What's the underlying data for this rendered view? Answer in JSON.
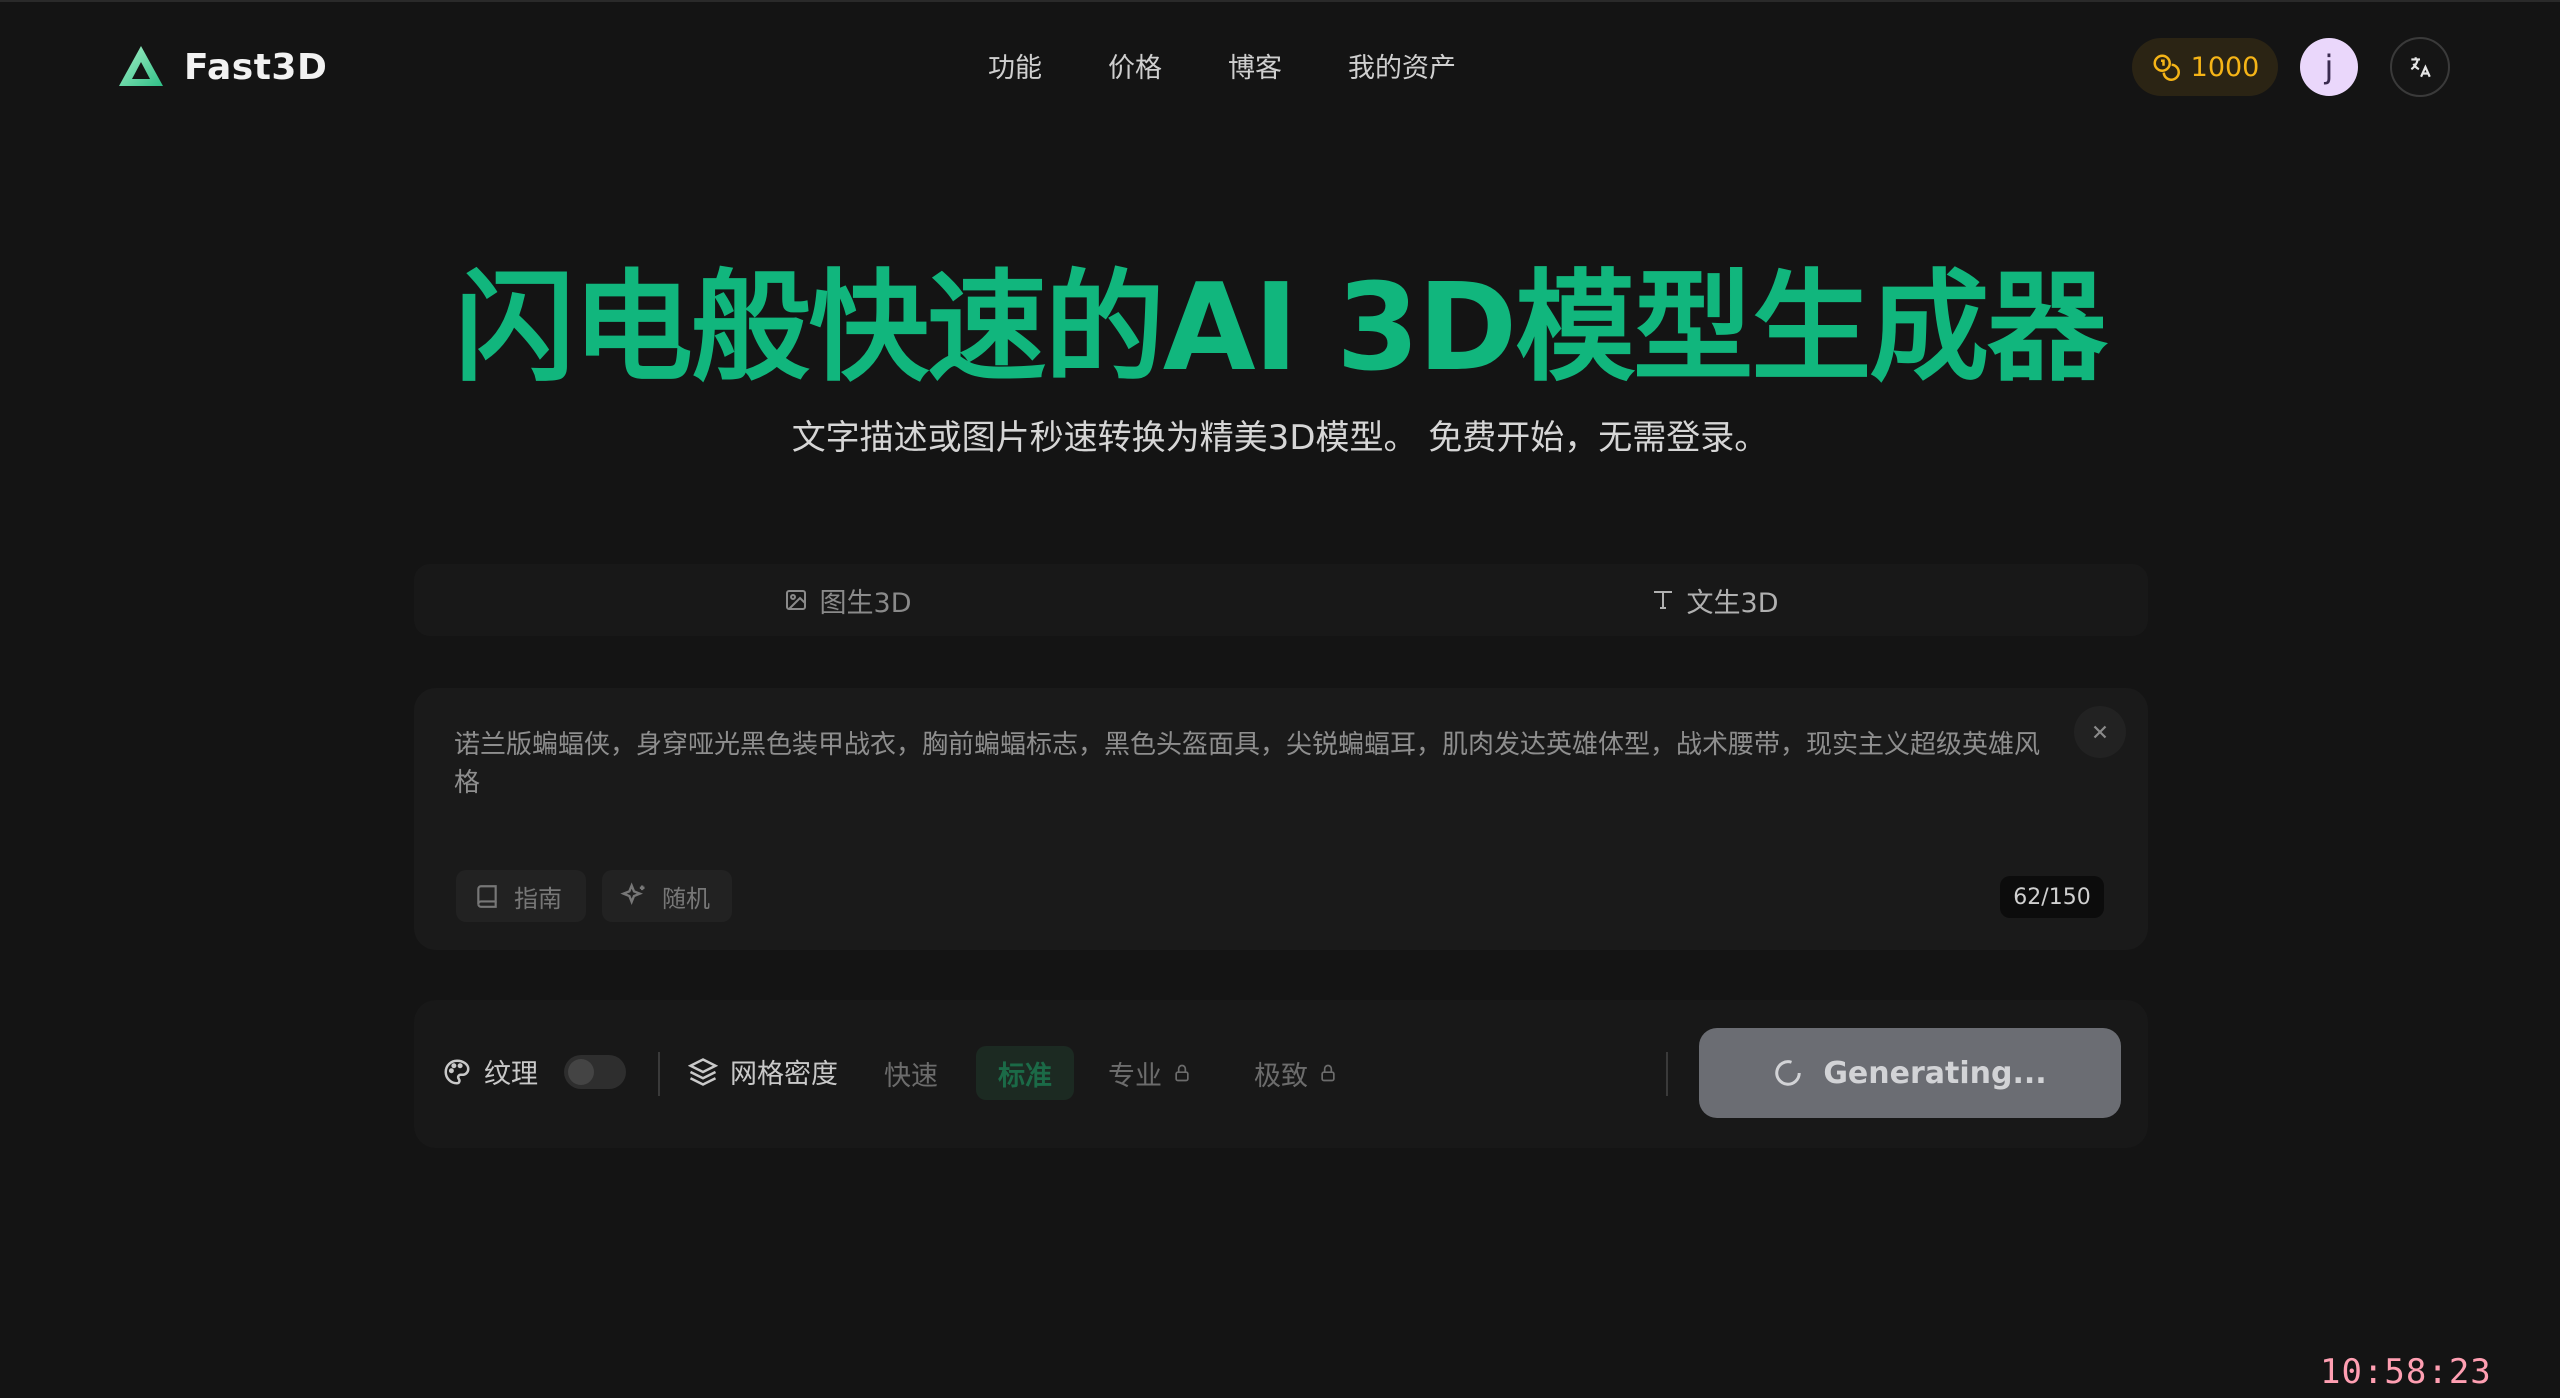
{
  "app": {
    "name": "Fast3D"
  },
  "nav": {
    "items": [
      "功能",
      "价格",
      "博客",
      "我的资产"
    ]
  },
  "header": {
    "credits": "1000",
    "avatar_letter": "j"
  },
  "hero": {
    "title": "闪电般快速的AI 3D模型生成器",
    "subtitle": "文字描述或图片秒速转换为精美3D模型。 免费开始，无需登录。"
  },
  "tabs": [
    {
      "label": "图生3D",
      "icon": "image-icon"
    },
    {
      "label": "文生3D",
      "icon": "text-icon",
      "active": true
    }
  ],
  "prompt": {
    "text": "诺兰版蝙蝠侠，身穿哑光黑色装甲战衣，胸前蝙蝠标志，黑色头盔面具，尖锐蝙蝠耳，肌肉发达英雄体型，战术腰带，现实主义超级英雄风格",
    "guide_label": "指南",
    "random_label": "随机",
    "counter": "62/150"
  },
  "options": {
    "texture_label": "纹理",
    "texture_enabled": false,
    "mesh_label": "网格密度",
    "density": [
      "快速",
      "标准",
      "专业",
      "极致"
    ],
    "density_selected": "标准",
    "generate_label": "Generating..."
  },
  "clock": "10:58:23",
  "colors": {
    "accent": "#11b67d",
    "background": "#141414",
    "credits": "#f5b417"
  }
}
